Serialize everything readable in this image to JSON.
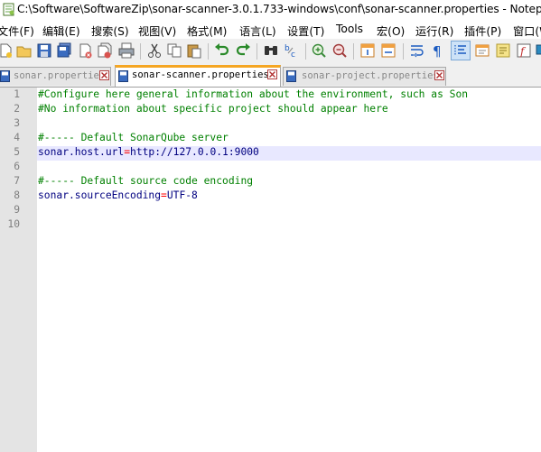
{
  "window": {
    "title": "C:\\Software\\SoftwareZip\\sonar-scanner-3.0.1.733-windows\\conf\\sonar-scanner.properties - Notepad"
  },
  "menu": [
    {
      "label": "文件(F)"
    },
    {
      "label": "编辑(E)"
    },
    {
      "label": "搜索(S)"
    },
    {
      "label": "视图(V)"
    },
    {
      "label": "格式(M)"
    },
    {
      "label": "语言(L)"
    },
    {
      "label": "设置(T)"
    },
    {
      "label": "Tools"
    },
    {
      "label": "宏(O)"
    },
    {
      "label": "运行(R)"
    },
    {
      "label": "插件(P)"
    },
    {
      "label": "窗口(W)"
    }
  ],
  "toolbar": {
    "icons": [
      "new-file-icon",
      "open-file-icon",
      "save-icon",
      "save-all-icon",
      "close-icon",
      "close-all-icon",
      "print-icon",
      "cut-icon",
      "copy-icon",
      "paste-icon",
      "undo-icon",
      "redo-icon",
      "find-icon",
      "replace-icon",
      "zoom-in-icon",
      "zoom-out-icon",
      "sync-vertical-icon",
      "sync-horizontal-icon",
      "word-wrap-icon",
      "show-all-chars-icon",
      "indent-guide-icon",
      "lang-define-icon",
      "doc-map-icon",
      "function-list-icon",
      "monitor-icon"
    ]
  },
  "tabs": [
    {
      "label": "sonar.properties",
      "active": false
    },
    {
      "label": "sonar-scanner.properties",
      "active": true
    },
    {
      "label": "sonar-project.properties",
      "active": false
    }
  ],
  "editor": {
    "current_line": 5,
    "lines": [
      {
        "num": "1",
        "type": "comment",
        "text": "#Configure here general information about the environment, such as Son"
      },
      {
        "num": "2",
        "type": "comment",
        "text": "#No information about specific project should appear here"
      },
      {
        "num": "3",
        "type": "blank",
        "text": ""
      },
      {
        "num": "4",
        "type": "comment",
        "text": "#----- Default SonarQube server"
      },
      {
        "num": "5",
        "type": "kv",
        "key": "sonar.host.url",
        "eq": "=",
        "value": "http://127.0.0.1:9000"
      },
      {
        "num": "6",
        "type": "blank",
        "text": ""
      },
      {
        "num": "7",
        "type": "comment",
        "text": "#----- Default source code encoding"
      },
      {
        "num": "8",
        "type": "kv",
        "key": "sonar.sourceEncoding",
        "eq": "=",
        "value": "UTF-8"
      },
      {
        "num": "9",
        "type": "blank",
        "text": ""
      },
      {
        "num": "10",
        "type": "blank",
        "text": ""
      }
    ]
  }
}
